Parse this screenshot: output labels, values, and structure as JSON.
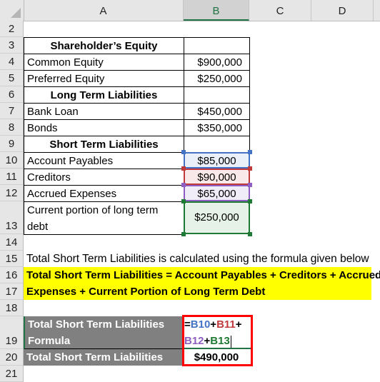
{
  "columns": [
    "A",
    "B",
    "C",
    "D"
  ],
  "selected_column": "B",
  "row_numbers": [
    "2",
    "3",
    "4",
    "5",
    "6",
    "7",
    "8",
    "9",
    "10",
    "11",
    "12",
    "13",
    "14",
    "15",
    "16",
    "17",
    "18",
    "19",
    "20",
    "21"
  ],
  "table": {
    "header_shareholders": "Shareholder’s Equity",
    "rows_equity": [
      {
        "label": "Common Equity",
        "value": "$900,000"
      },
      {
        "label": "Preferred Equity",
        "value": "$250,000"
      }
    ],
    "header_long_term": "Long Term Liabilities",
    "rows_long_term": [
      {
        "label": "Bank Loan",
        "value": "$450,000"
      },
      {
        "label": "Bonds",
        "value": "$350,000"
      }
    ],
    "header_short_term": "Short Term Liabilities",
    "rows_short_term": [
      {
        "label": "Account Payables",
        "value": "$85,000",
        "ref_color": "#4472c4",
        "fill": "#eaf0fa"
      },
      {
        "label": "Creditors",
        "value": "$90,000",
        "ref_color": "#c0393b",
        "fill": "#fae9e9"
      },
      {
        "label": "Accrued Expenses",
        "value": "$65,000",
        "ref_color": "#8e5fc0",
        "fill": "#f1edf8"
      },
      {
        "label_line1": "Current portion of long term",
        "label_line2": "debt",
        "value": "$250,000",
        "ref_color": "#1e7a34",
        "fill": "#e6f2e8"
      }
    ]
  },
  "note": "Total Short Term Liabilities is calculated using the formula given below",
  "formula_text_line1": "Total Short Term Liabilities = Account Payables + Creditors + Accrued",
  "formula_text_line2": "Expenses + Current Portion of Long Term Debt",
  "result": {
    "formula_label_line1": "Total Short Term Liabilities",
    "formula_label_line2": "Formula",
    "formula_parts": {
      "eq": "=",
      "b10": "B10",
      "plus1": "+",
      "b11": "B11",
      "plus2": "+",
      "b12": "B12",
      "plus3": "+",
      "b13": "B13"
    },
    "total_label": "Total Short Term Liabilities",
    "total_value": "$490,000"
  },
  "colors": {
    "highlight_box": "#ff0000",
    "excel_green": "#217346",
    "grey_fill": "#808080",
    "yellow_fill": "#ffff00"
  }
}
